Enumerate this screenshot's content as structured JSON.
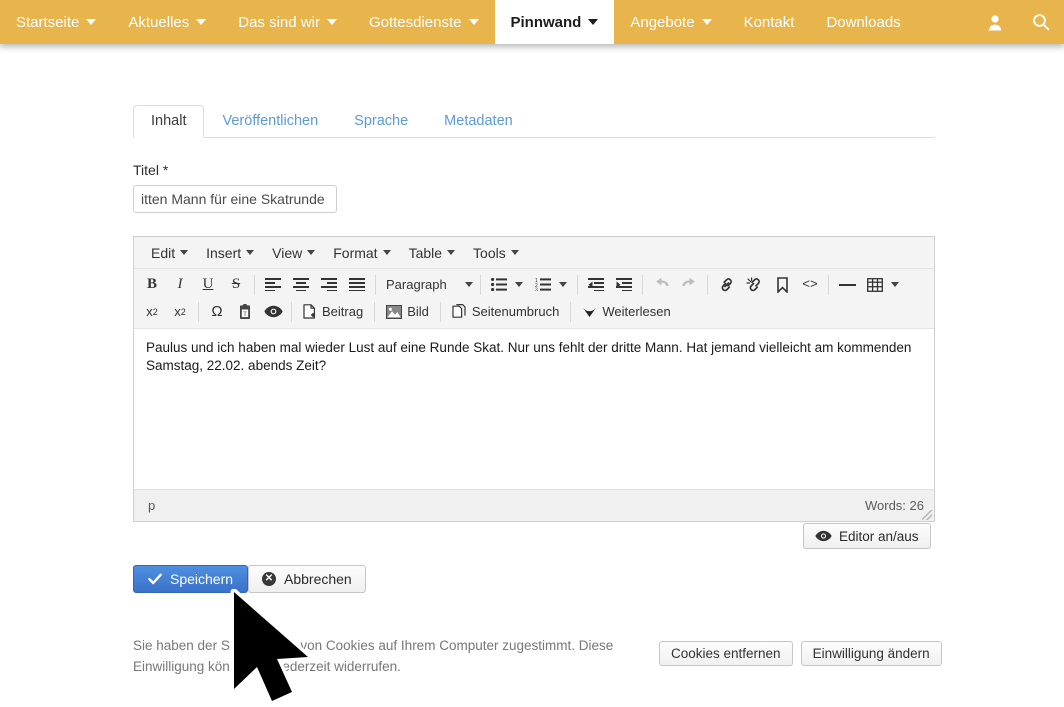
{
  "navbar": {
    "background_color": "#e8b44c",
    "items": [
      {
        "label": "Startseite",
        "has_caret": true,
        "active": false
      },
      {
        "label": "Aktuelles",
        "has_caret": true,
        "active": false
      },
      {
        "label": "Das sind wir",
        "has_caret": true,
        "active": false
      },
      {
        "label": "Gottesdienste",
        "has_caret": true,
        "active": false
      },
      {
        "label": "Pinnwand",
        "has_caret": true,
        "active": true
      },
      {
        "label": "Angebote",
        "has_caret": true,
        "active": false
      },
      {
        "label": "Kontakt",
        "has_caret": false,
        "active": false
      },
      {
        "label": "Downloads",
        "has_caret": false,
        "active": false
      }
    ],
    "icons": [
      {
        "name": "user-icon"
      },
      {
        "name": "search-icon"
      }
    ]
  },
  "tabs": [
    {
      "label": "Inhalt",
      "active": true
    },
    {
      "label": "Veröffentlichen",
      "active": false
    },
    {
      "label": "Sprache",
      "active": false
    },
    {
      "label": "Metadaten",
      "active": false
    }
  ],
  "form": {
    "title_label": "Titel *",
    "title_value": "itten Mann für eine Skatrunde",
    "title_placeholder": "",
    "save_label": "Speichern",
    "cancel_label": "Abbrechen",
    "editor_toggle_label": "Editor an/aus"
  },
  "editor": {
    "menus": [
      "Edit",
      "Insert",
      "View",
      "Format",
      "Table",
      "Tools"
    ],
    "toolbar_row1": [
      {
        "name": "bold-icon",
        "glyph": "B"
      },
      {
        "name": "italic-icon",
        "glyph": "I"
      },
      {
        "name": "underline-icon",
        "glyph": "U"
      },
      {
        "name": "strikethrough-icon",
        "glyph": "S"
      },
      {
        "name": "align-left-icon"
      },
      {
        "name": "align-center-icon"
      },
      {
        "name": "align-right-icon"
      },
      {
        "name": "align-justify-icon"
      },
      {
        "name": "style-select",
        "label": "Paragraph"
      },
      {
        "name": "bullet-list-icon"
      },
      {
        "name": "numbered-list-icon"
      },
      {
        "name": "outdent-icon"
      },
      {
        "name": "indent-icon"
      },
      {
        "name": "undo-icon",
        "disabled": true
      },
      {
        "name": "redo-icon",
        "disabled": true
      },
      {
        "name": "link-icon"
      },
      {
        "name": "unlink-icon"
      },
      {
        "name": "anchor-icon"
      },
      {
        "name": "source-code-icon",
        "glyph": "<>"
      },
      {
        "name": "horizontal-rule-icon"
      },
      {
        "name": "table-icon"
      }
    ],
    "toolbar_row2": [
      {
        "name": "subscript-icon"
      },
      {
        "name": "superscript-icon"
      },
      {
        "name": "special-character-icon",
        "glyph": "Ω"
      },
      {
        "name": "paste-as-text-icon"
      },
      {
        "name": "preview-icon"
      },
      {
        "name": "insert-beitrag-button",
        "label": "Beitrag"
      },
      {
        "name": "insert-bild-button",
        "label": "Bild"
      },
      {
        "name": "insert-seitenumbruch-button",
        "label": "Seitenumbruch"
      },
      {
        "name": "insert-weiterlesen-button",
        "label": "Weiterlesen"
      }
    ],
    "body_text": "Paulus und ich haben mal wieder Lust auf eine Runde Skat. Nur uns fehlt der dritte Mann. Hat jemand vielleicht am kommenden Samstag, 22.02. abends Zeit?",
    "status_path": "p",
    "status_words": "Words: 26"
  },
  "cookie_bar": {
    "text": "Sie haben der Speicherung von Cookies auf Ihrem Computer zugestimmt. Diese Einwilligung können Sie jederzeit widerrufen.",
    "remove_label": "Cookies entfernen",
    "change_label": "Einwilligung ändern"
  }
}
